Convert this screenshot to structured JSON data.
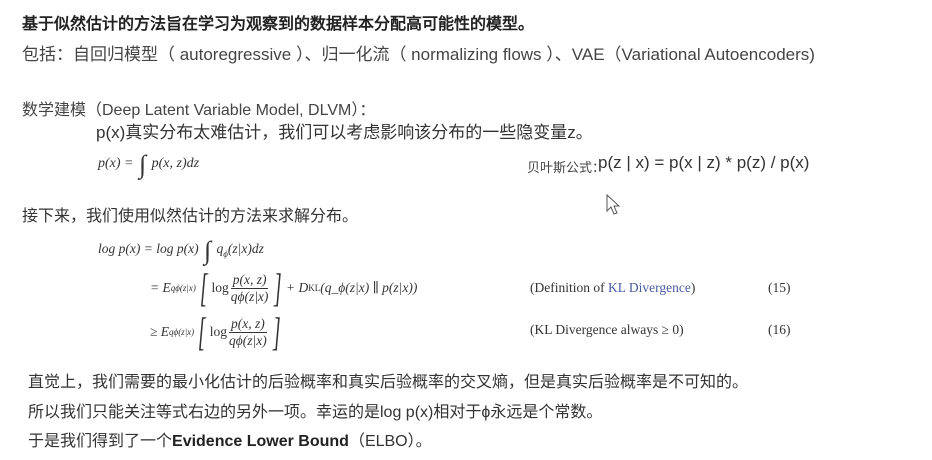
{
  "intro": {
    "headline": "基于似然估计的方法旨在学习为观察到的数据样本分配高可能性的模型。",
    "includes": "包括：自回归模型（ autoregressive ）、归一化流（ normalizing flows ）、VAE（Variational Autoencoders)"
  },
  "dlvm": {
    "title": "数学建模（Deep Latent Variable Model, DLVM）：",
    "desc": "p(x)真实分布太难估计，我们可以考虑影响该分布的一些隐变量z。",
    "eq_lhs": "p(x) =",
    "eq_rhs": "p(x, z)dz",
    "bayes_label": "贝叶斯公式：",
    "bayes_formula": "p(z | x) = p(x | z) * p(z) / p(x)"
  },
  "method": {
    "title": "接下来，我们使用似然估计的方法来求解分布。",
    "eq_line1_lhs": "log p(x) = log p(x)",
    "eq_line1_rhs": "q",
    "eq_line1_tail": "(z|x)dz",
    "eq15_prefix": "= E",
    "eq15_kl": "+ D",
    "eq15_kl_tail": "(q_ϕ(z|x) ∥ p(z|x))",
    "eq16_prefix": "≥ E",
    "sub_q": "qϕ(z|x)",
    "log": "log",
    "frac_num": "p(x, z)",
    "frac_den": "qϕ(z|x)",
    "kl_sub": "KL",
    "note15_pre": "(Definition of ",
    "note15_link": "KL Divergence",
    "note15_post": ")",
    "note16": "(KL Divergence always ≥ 0)",
    "num15": "(15)",
    "num16": "(16)"
  },
  "conclusion": {
    "line1": "直觉上，我们需要的最小化估计的后验概率和真实后验概率的交叉熵，但是真实后验概率是不可知的。",
    "line2": "所以我们只能关注等式右边的另外一项。幸运的是log p(x)相对于ϕ永远是个常数。",
    "line3_pre": "于是我们得到了一个",
    "line3_bold": "Evidence Lower Bound",
    "line3_post": "（ELBO）。"
  },
  "colors": {
    "link": "#4a5aa0",
    "text": "#333333"
  },
  "icons": {
    "cursor": "mouse-pointer-icon"
  }
}
